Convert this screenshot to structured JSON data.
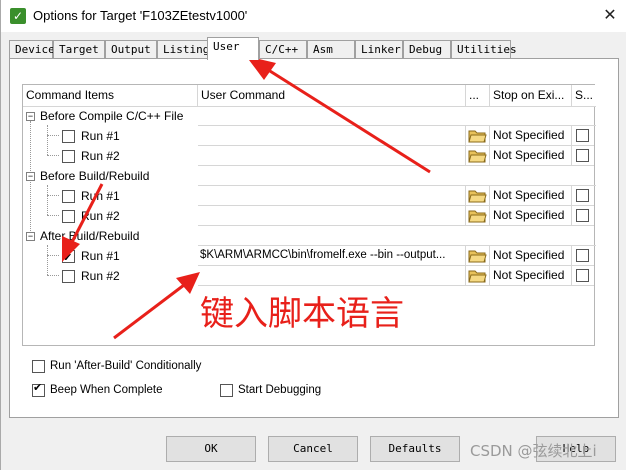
{
  "window": {
    "title": "Options for Target 'F103ZEtestv1000'"
  },
  "tabs": [
    {
      "label": "Device"
    },
    {
      "label": "Target"
    },
    {
      "label": "Output"
    },
    {
      "label": "Listing"
    },
    {
      "label": "User",
      "active": true
    },
    {
      "label": "C/C++"
    },
    {
      "label": "Asm"
    },
    {
      "label": "Linker"
    },
    {
      "label": "Debug"
    },
    {
      "label": "Utilities"
    }
  ],
  "grid": {
    "headers": {
      "command_items": "Command Items",
      "user_command": "User Command",
      "browse": "...",
      "stop_on_exit": "Stop on Exi...",
      "s": "S..."
    },
    "groups": [
      {
        "label": "Before Compile C/C++ File",
        "runs": [
          {
            "label": "Run #1",
            "checked": false,
            "command": "",
            "stop": "Not Specified"
          },
          {
            "label": "Run #2",
            "checked": false,
            "command": "",
            "stop": "Not Specified"
          }
        ]
      },
      {
        "label": "Before Build/Rebuild",
        "runs": [
          {
            "label": "Run #1",
            "checked": false,
            "command": "",
            "stop": "Not Specified"
          },
          {
            "label": "Run #2",
            "checked": false,
            "command": "",
            "stop": "Not Specified"
          }
        ]
      },
      {
        "label": "After Build/Rebuild",
        "runs": [
          {
            "label": "Run #1",
            "checked": true,
            "command": "$K\\ARM\\ARMCC\\bin\\fromelf.exe --bin --output...",
            "stop": "Not Specified"
          },
          {
            "label": "Run #2",
            "checked": false,
            "command": "",
            "stop": "Not Specified"
          }
        ]
      }
    ]
  },
  "options": {
    "run_after_build": {
      "label": "Run 'After-Build' Conditionally",
      "checked": false
    },
    "beep": {
      "label": "Beep When Complete",
      "checked": true
    },
    "start_debugging": {
      "label": "Start Debugging",
      "checked": false
    }
  },
  "buttons": {
    "ok": "OK",
    "cancel": "Cancel",
    "defaults": "Defaults",
    "help": "Help"
  },
  "annotation": {
    "text": "键入脚本语言",
    "color": "#e8201a"
  },
  "watermark": "CSDN @弦续北上i"
}
